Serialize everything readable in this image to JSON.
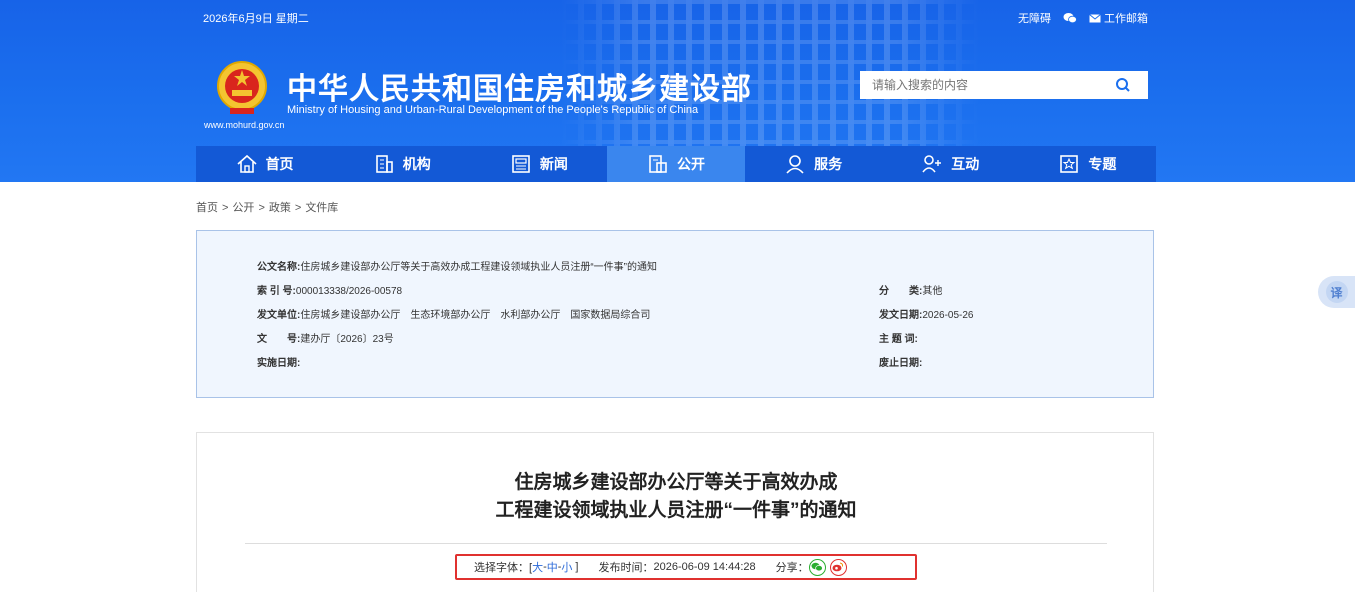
{
  "header": {
    "date": "2026年6月9日 星期二",
    "links": {
      "accessibility": "无障碍",
      "mail": "工作邮箱"
    },
    "title_cn": "中华人民共和国住房和城乡建设部",
    "title_en": "Ministry of Housing and Urban-Rural Development of the People's Republic of China",
    "site_url": "www.mohurd.gov.cn",
    "search_placeholder": "请输入搜索的内容"
  },
  "nav": [
    {
      "label": "首页",
      "icon": "home-icon"
    },
    {
      "label": "机构",
      "icon": "building-icon"
    },
    {
      "label": "新闻",
      "icon": "news-icon"
    },
    {
      "label": "公开",
      "icon": "public-icon",
      "active": true
    },
    {
      "label": "服务",
      "icon": "service-icon"
    },
    {
      "label": "互动",
      "icon": "interact-icon"
    },
    {
      "label": "专题",
      "icon": "star-icon"
    }
  ],
  "breadcrumb": [
    "首页",
    "公开",
    "政策",
    "文件库"
  ],
  "info": {
    "doc_name_label": "公文名称:",
    "doc_name": "住房城乡建设部办公厅等关于高效办成工程建设领域执业人员注册“一件事”的通知",
    "index_label": "索 引 号:",
    "index": "000013338/2026-00578",
    "category_label": "分　　类:",
    "category": "其他",
    "issuer_label": "发文单位:",
    "issuer": "住房城乡建设部办公厅　生态环境部办公厅　水利部办公厅　国家数据局综合司",
    "issue_date_label": "发文日期:",
    "issue_date": "2026-05-26",
    "doc_no_label": "文　　号:",
    "doc_no": "建办厅〔2026〕23号",
    "subject_label": "主 题 词:",
    "subject": "",
    "effective_label": "实施日期:",
    "effective": "",
    "expiry_label": "废止日期:",
    "expiry": ""
  },
  "article": {
    "title_line1": "住房城乡建设部办公厅等关于高效办成",
    "title_line2": "工程建设领域执业人员注册“一件事”的通知",
    "font_select_label": "选择字体：[",
    "font_large": "大",
    "font_medium": "中",
    "font_small": "小",
    "font_close": "]",
    "publish_label": "发布时间：",
    "publish_time": "2026-06-09 14:44:28",
    "share_label": "分享："
  },
  "translate_label": "译",
  "colors": {
    "primary": "#1b6fee",
    "nav": "#1359d6",
    "nav_active": "#3a86ee",
    "info_bg": "#f0f6fe",
    "highlight": "#e0312f",
    "link": "#2d6bd9"
  }
}
